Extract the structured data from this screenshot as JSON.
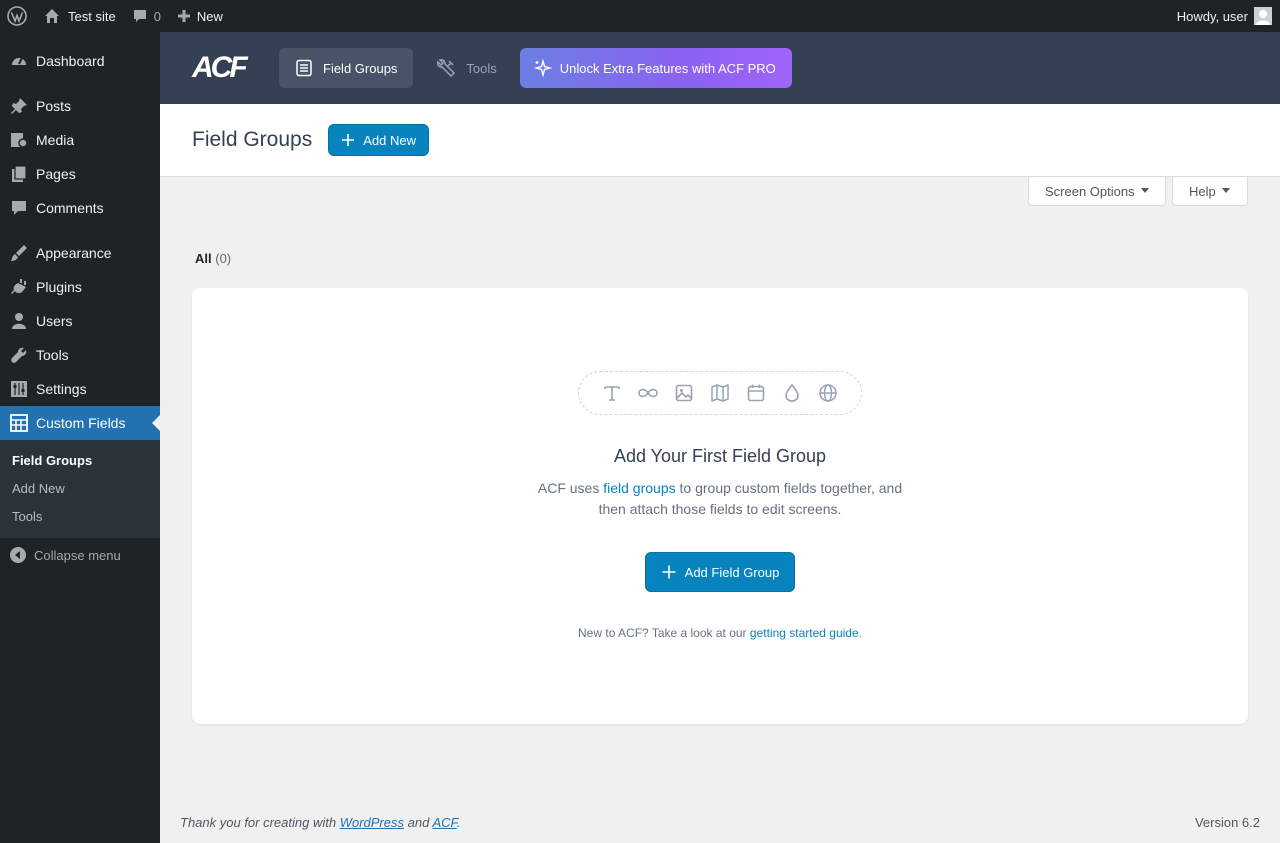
{
  "adminbar": {
    "site_name": "Test site",
    "comments_count": "0",
    "new_label": "New",
    "howdy": "Howdy, user"
  },
  "sidebar": {
    "items": [
      {
        "label": "Dashboard",
        "icon": "dashboard-icon"
      },
      {
        "label": "Posts",
        "icon": "pushpin-icon"
      },
      {
        "label": "Media",
        "icon": "media-icon"
      },
      {
        "label": "Pages",
        "icon": "pages-icon"
      },
      {
        "label": "Comments",
        "icon": "comment-icon"
      },
      {
        "label": "Appearance",
        "icon": "brush-icon"
      },
      {
        "label": "Plugins",
        "icon": "plug-icon"
      },
      {
        "label": "Users",
        "icon": "user-icon"
      },
      {
        "label": "Tools",
        "icon": "wrench-icon"
      },
      {
        "label": "Settings",
        "icon": "sliders-icon"
      },
      {
        "label": "Custom Fields",
        "icon": "table-icon"
      }
    ],
    "submenu": [
      "Field Groups",
      "Add New",
      "Tools"
    ],
    "collapse": "Collapse menu"
  },
  "acf_header": {
    "logo": "ACF",
    "tabs": [
      "Field Groups",
      "Tools"
    ],
    "pro_label": "Unlock Extra Features with ACF PRO"
  },
  "titlebar": {
    "title": "Field Groups",
    "add_new": "Add New"
  },
  "screen_meta": {
    "screen_options": "Screen Options",
    "help": "Help"
  },
  "views": {
    "all_label": "All",
    "all_count": "(0)"
  },
  "empty_state": {
    "title": "Add Your First Field Group",
    "desc_before": "ACF uses ",
    "desc_link": "field groups",
    "desc_after": " to group custom fields together, and then attach those fields to edit screens.",
    "button": "Add Field Group",
    "guide_before": "New to ACF? Take a look at our ",
    "guide_link": "getting started guide",
    "guide_after": "."
  },
  "footer": {
    "thanks_before": "Thank you for creating with ",
    "wordpress": "WordPress",
    "and": " and ",
    "acf": "ACF",
    "period": ".",
    "version": "Version 6.2"
  },
  "colors": {
    "admin_dark": "#1d2327",
    "wp_blue": "#2271b1",
    "acf_header": "#344054",
    "acf_blue": "#0783be"
  }
}
